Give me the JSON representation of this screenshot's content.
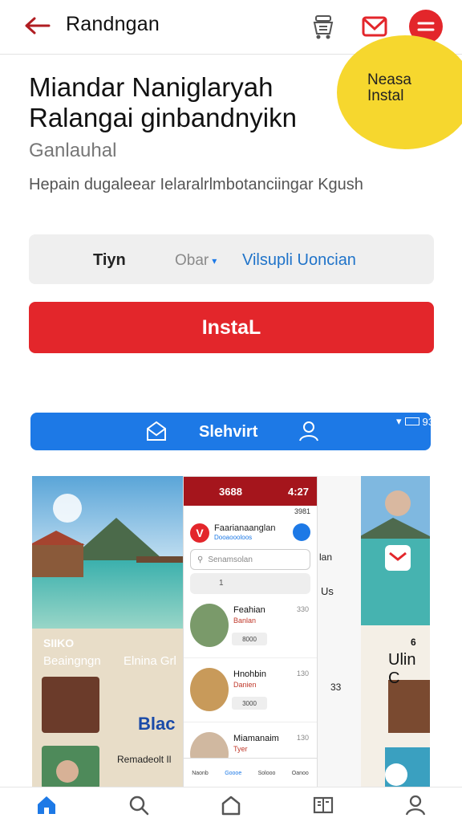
{
  "header": {
    "title": "Randngan",
    "icons": [
      "back-arrow-icon",
      "cart-icon",
      "mail-icon",
      "menu-icon"
    ],
    "accent": "#e3262b"
  },
  "sticker": {
    "text": "Neasa Instal",
    "color": "#f6d72e"
  },
  "app": {
    "headline": "Miandar Naniglaryah Ralangai ginbandnyikn",
    "subheading": "Ganlauhal",
    "description": "Hepain dugaleear Ielaralrlmbotanciingar Kgush"
  },
  "info": {
    "label": "Tiyn",
    "select_value": "Obar",
    "link": "Vilsupli Uoncian"
  },
  "install": {
    "label": "InstaL"
  },
  "banner": {
    "text": "Slehvirt",
    "status": "93",
    "color": "#1d79e6"
  },
  "gallery": {
    "left": {
      "caption1": "SIIKO",
      "caption2": "Beaingngn",
      "caption3": "Elnina Grl",
      "caption4": "Blac",
      "caption5": "Remadeolt Il"
    },
    "phone": {
      "time_left": "3688",
      "time_right": "4:27",
      "sub_status": "3981",
      "app_title": "Faarianaanglan",
      "app_subtitle": "Dooaoooloos",
      "search_placeholder": "Senamsolan",
      "search2": "1",
      "items": [
        {
          "title": "Feahian",
          "sub": "Banlan",
          "meta": "330",
          "chip": "8000"
        },
        {
          "title": "Hnohbin",
          "sub": "Danien",
          "meta": "130",
          "chip": "3000"
        },
        {
          "title": "Miamanaim",
          "sub": "Tyer",
          "meta": "130",
          "chip": ""
        }
      ],
      "tabs": [
        "Naonb",
        "Goooe",
        "Solooo",
        "Oanoo"
      ]
    },
    "right": {
      "caption1": "lan",
      "caption2": "Us",
      "caption3": "Ulin C",
      "caption4": "33",
      "caption5": "6"
    }
  },
  "bottom_nav": {
    "items": [
      "home-icon",
      "search-icon",
      "library-icon",
      "book-icon",
      "profile-icon"
    ],
    "active_color": "#1d79e6"
  }
}
